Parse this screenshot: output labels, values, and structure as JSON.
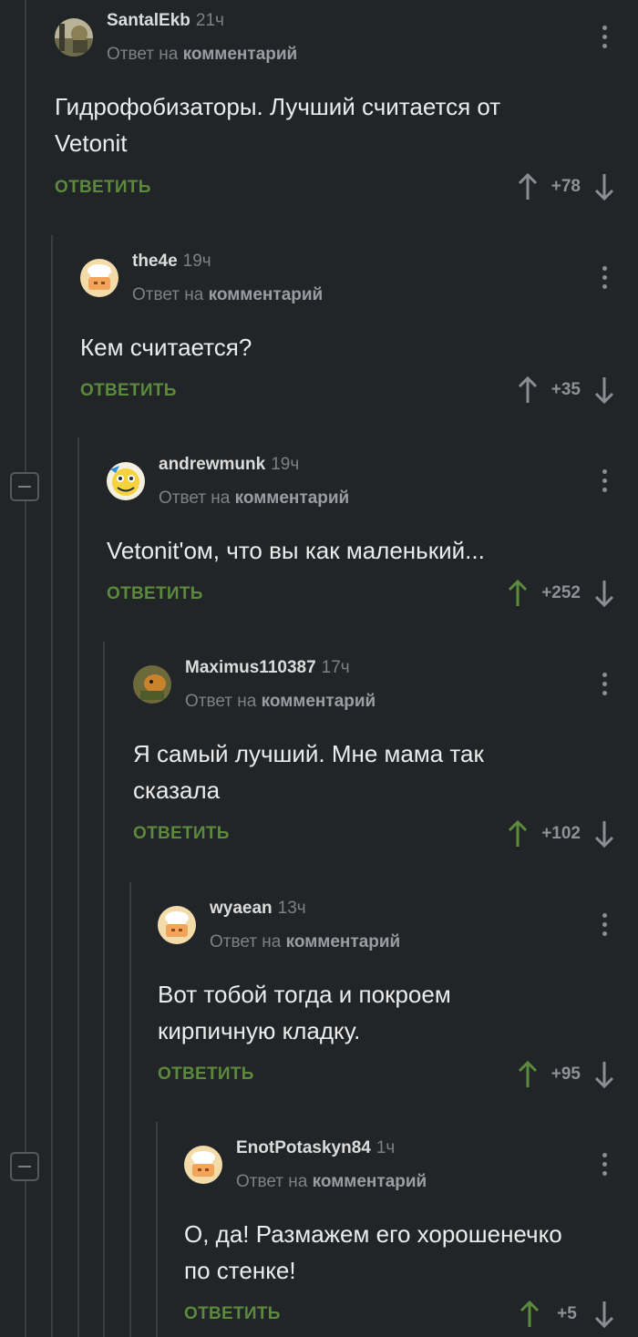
{
  "comments": [
    {
      "user": "SantalEkb",
      "time": "21ч",
      "reply_prefix": "Ответ на",
      "reply_target": "комментарий",
      "lines": [
        "Гидрофобизаторы. Лучший считается от",
        "Vetonit"
      ],
      "reply_label": "ОТВЕТИТЬ",
      "score": "+78",
      "upvoted": false,
      "avatar_icon": "photo-avatar"
    },
    {
      "user": "the4e",
      "time": "19ч",
      "reply_prefix": "Ответ на",
      "reply_target": "комментарий",
      "lines": [
        "Кем считается?"
      ],
      "reply_label": "ОТВЕТИТЬ",
      "score": "+35",
      "upvoted": false,
      "avatar_icon": "default-chef-avatar"
    },
    {
      "user": "andrewmunk",
      "time": "19ч",
      "reply_prefix": "Ответ на",
      "reply_target": "комментарий",
      "lines": [
        "Vetonit'ом, что вы как маленький..."
      ],
      "reply_label": "ОТВЕТИТЬ",
      "score": "+252",
      "upvoted": true,
      "avatar_icon": "cartoon-avatar"
    },
    {
      "user": "Maximus110387",
      "time": "17ч",
      "reply_prefix": "Ответ на",
      "reply_target": "комментарий",
      "lines": [
        "Я самый лучший. Мне мама так",
        "сказала"
      ],
      "reply_label": "ОТВЕТИТЬ",
      "score": "+102",
      "upvoted": true,
      "avatar_icon": "photo-avatar"
    },
    {
      "user": "wyaean",
      "time": "13ч",
      "reply_prefix": "Ответ на",
      "reply_target": "комментарий",
      "lines": [
        "Вот тобой тогда и покроем",
        "кирпичную кладку."
      ],
      "reply_label": "ОТВЕТИТЬ",
      "score": "+95",
      "upvoted": true,
      "avatar_icon": "default-chef-avatar"
    },
    {
      "user": "EnotPotaskyn84",
      "time": "1ч",
      "reply_prefix": "Ответ на",
      "reply_target": "комментарий",
      "lines": [
        "О, да! Размажем его хорошенечко",
        "по стенке!"
      ],
      "reply_label": "ОТВЕТИТЬ",
      "score": "+5",
      "upvoted": true,
      "avatar_icon": "default-chef-avatar"
    }
  ],
  "colors": {
    "background": "#222527",
    "accent_green": "#5c8a3c",
    "muted": "#7d8185"
  }
}
